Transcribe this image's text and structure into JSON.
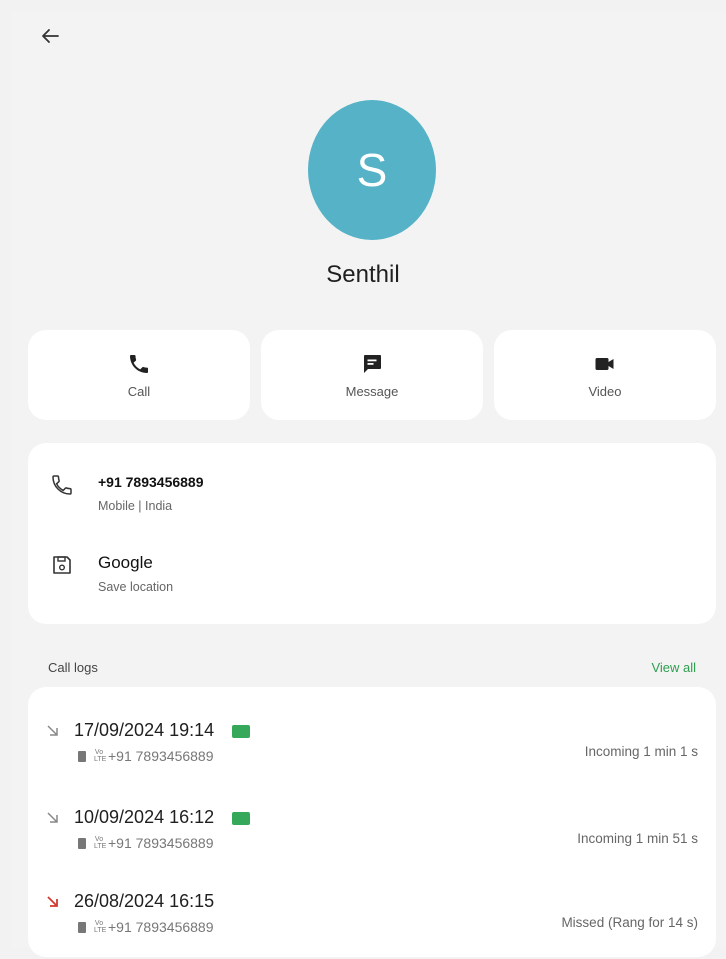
{
  "contact": {
    "initial": "S",
    "name": "Senthil",
    "avatar_color": "#55b2c7"
  },
  "actions": [
    {
      "label": "Call",
      "icon": "phone-icon"
    },
    {
      "label": "Message",
      "icon": "message-icon"
    },
    {
      "label": "Video",
      "icon": "video-icon"
    }
  ],
  "details": {
    "phone": {
      "number": "+91 7893456889",
      "sub": "Mobile  |  India",
      "icon": "phone-outline-icon"
    },
    "account": {
      "name": "Google",
      "sub": "Save location",
      "icon": "save-icon"
    }
  },
  "call_logs": {
    "title": "Call logs",
    "view_all": "View all",
    "accent": "#2e9e4f",
    "items": [
      {
        "datetime": "17/09/2024 19:14",
        "number": "+91 7893456889",
        "status": "Incoming  1 min 1 s",
        "direction": "incoming",
        "recorded": true
      },
      {
        "datetime": "10/09/2024 16:12",
        "number": "+91 7893456889",
        "status": "Incoming  1 min 51 s",
        "direction": "incoming",
        "recorded": true
      },
      {
        "datetime": "26/08/2024 16:15",
        "number": "+91 7893456889",
        "status": "Missed (Rang for 14 s)",
        "direction": "missed",
        "recorded": false
      }
    ]
  }
}
